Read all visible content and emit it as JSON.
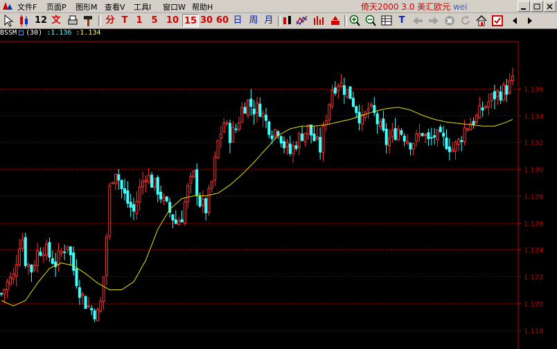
{
  "menu": {
    "items": [
      "文件F",
      "页面P",
      "图形M",
      "查看V",
      "工具I",
      "窗口W",
      "帮助H"
    ]
  },
  "window": {
    "title_prefix": "倚天2000 3.0 美汇欧元",
    "title_user": "wei"
  },
  "toolbar": {
    "period_buttons": [
      "12",
      "文",
      "分",
      "T",
      "1",
      "5",
      "10",
      "15",
      "30",
      "60",
      "日",
      "周",
      "月"
    ],
    "active_period": "15",
    "t_label": "T"
  },
  "indicator": {
    "name": "BSSM",
    "param": "(30)",
    "value1": ":1.136",
    "value2": ":1.134"
  },
  "chart_data": {
    "type": "candlestick",
    "instrument": "美汇欧元",
    "period": "15",
    "ylim": [
      1.117,
      1.1395
    ],
    "y_ticks": [
      "1.118",
      "1.120",
      "1.122",
      "1.124",
      "1.126",
      "1.128",
      "1.130",
      "1.132",
      "1.134",
      "1.136"
    ],
    "grid": true,
    "colors": {
      "up": "#ff3030",
      "down": "#40ffff",
      "ma": "#e8e000",
      "axis": "#c00000",
      "tick_text": "#c00000"
    },
    "price_keypoints": [
      [
        0,
        1.1207
      ],
      [
        2,
        1.1215
      ],
      [
        4,
        1.122
      ],
      [
        6,
        1.1245
      ],
      [
        7,
        1.1248
      ],
      [
        8,
        1.1232
      ],
      [
        10,
        1.1225
      ],
      [
        12,
        1.1238
      ],
      [
        14,
        1.1242
      ],
      [
        16,
        1.1235
      ],
      [
        18,
        1.123
      ],
      [
        20,
        1.1238
      ],
      [
        22,
        1.1245
      ],
      [
        24,
        1.1225
      ],
      [
        26,
        1.121
      ],
      [
        28,
        1.12
      ],
      [
        30,
        1.1195
      ],
      [
        32,
        1.1192
      ],
      [
        33,
        1.12
      ],
      [
        34,
        1.122
      ],
      [
        35,
        1.125
      ],
      [
        36,
        1.1285
      ],
      [
        37,
        1.1295
      ],
      [
        38,
        1.13
      ],
      [
        40,
        1.1285
      ],
      [
        42,
        1.1275
      ],
      [
        44,
        1.1268
      ],
      [
        46,
        1.1285
      ],
      [
        48,
        1.1297
      ],
      [
        50,
        1.129
      ],
      [
        52,
        1.1285
      ],
      [
        54,
        1.1275
      ],
      [
        56,
        1.1268
      ],
      [
        58,
        1.126
      ],
      [
        60,
        1.1265
      ],
      [
        62,
        1.1285
      ],
      [
        64,
        1.1295
      ],
      [
        66,
        1.1275
      ],
      [
        68,
        1.127
      ],
      [
        70,
        1.129
      ],
      [
        72,
        1.132
      ],
      [
        74,
        1.1335
      ],
      [
        76,
        1.1325
      ],
      [
        78,
        1.133
      ],
      [
        80,
        1.1345
      ],
      [
        82,
        1.135
      ],
      [
        84,
        1.1345
      ],
      [
        86,
        1.1345
      ],
      [
        88,
        1.1335
      ],
      [
        90,
        1.1328
      ],
      [
        92,
        1.133
      ],
      [
        94,
        1.1318
      ],
      [
        96,
        1.1312
      ],
      [
        98,
        1.132
      ],
      [
        100,
        1.1326
      ],
      [
        102,
        1.133
      ],
      [
        104,
        1.1322
      ],
      [
        106,
        1.1315
      ],
      [
        108,
        1.134
      ],
      [
        110,
        1.136
      ],
      [
        112,
        1.1365
      ],
      [
        114,
        1.136
      ],
      [
        116,
        1.1355
      ],
      [
        118,
        1.1345
      ],
      [
        120,
        1.1335
      ],
      [
        122,
        1.1345
      ],
      [
        124,
        1.134
      ],
      [
        126,
        1.133
      ],
      [
        128,
        1.132
      ],
      [
        130,
        1.1325
      ],
      [
        132,
        1.133
      ],
      [
        134,
        1.1325
      ],
      [
        136,
        1.132
      ],
      [
        138,
        1.1322
      ],
      [
        140,
        1.1328
      ],
      [
        142,
        1.132
      ],
      [
        144,
        1.1325
      ],
      [
        146,
        1.1322
      ],
      [
        148,
        1.132
      ],
      [
        150,
        1.1315
      ],
      [
        152,
        1.132
      ],
      [
        154,
        1.133
      ],
      [
        156,
        1.1335
      ],
      [
        158,
        1.1338
      ],
      [
        160,
        1.1345
      ],
      [
        162,
        1.135
      ],
      [
        164,
        1.1355
      ],
      [
        166,
        1.1357
      ],
      [
        168,
        1.136
      ],
      [
        170,
        1.1365
      ]
    ],
    "ma_keypoints": [
      [
        0,
        1.1202
      ],
      [
        4,
        1.1198
      ],
      [
        8,
        1.1202
      ],
      [
        12,
        1.1215
      ],
      [
        16,
        1.1226
      ],
      [
        20,
        1.123
      ],
      [
        24,
        1.1228
      ],
      [
        28,
        1.1222
      ],
      [
        32,
        1.1215
      ],
      [
        36,
        1.121
      ],
      [
        40,
        1.121
      ],
      [
        44,
        1.1216
      ],
      [
        48,
        1.1232
      ],
      [
        52,
        1.1255
      ],
      [
        56,
        1.127
      ],
      [
        60,
        1.1278
      ],
      [
        64,
        1.128
      ],
      [
        68,
        1.128
      ],
      [
        72,
        1.1282
      ],
      [
        76,
        1.1288
      ],
      [
        80,
        1.1296
      ],
      [
        84,
        1.1305
      ],
      [
        88,
        1.1315
      ],
      [
        92,
        1.1325
      ],
      [
        96,
        1.133
      ],
      [
        100,
        1.1332
      ],
      [
        104,
        1.1332
      ],
      [
        108,
        1.1333
      ],
      [
        112,
        1.1335
      ],
      [
        116,
        1.1337
      ],
      [
        120,
        1.134
      ],
      [
        124,
        1.1343
      ],
      [
        128,
        1.1345
      ],
      [
        132,
        1.1346
      ],
      [
        136,
        1.1344
      ],
      [
        140,
        1.134
      ],
      [
        144,
        1.1337
      ],
      [
        148,
        1.1335
      ],
      [
        152,
        1.1334
      ],
      [
        156,
        1.1333
      ],
      [
        160,
        1.1332
      ],
      [
        164,
        1.1332
      ],
      [
        168,
        1.1335
      ],
      [
        170,
        1.1337
      ]
    ],
    "bar_count": 171
  }
}
